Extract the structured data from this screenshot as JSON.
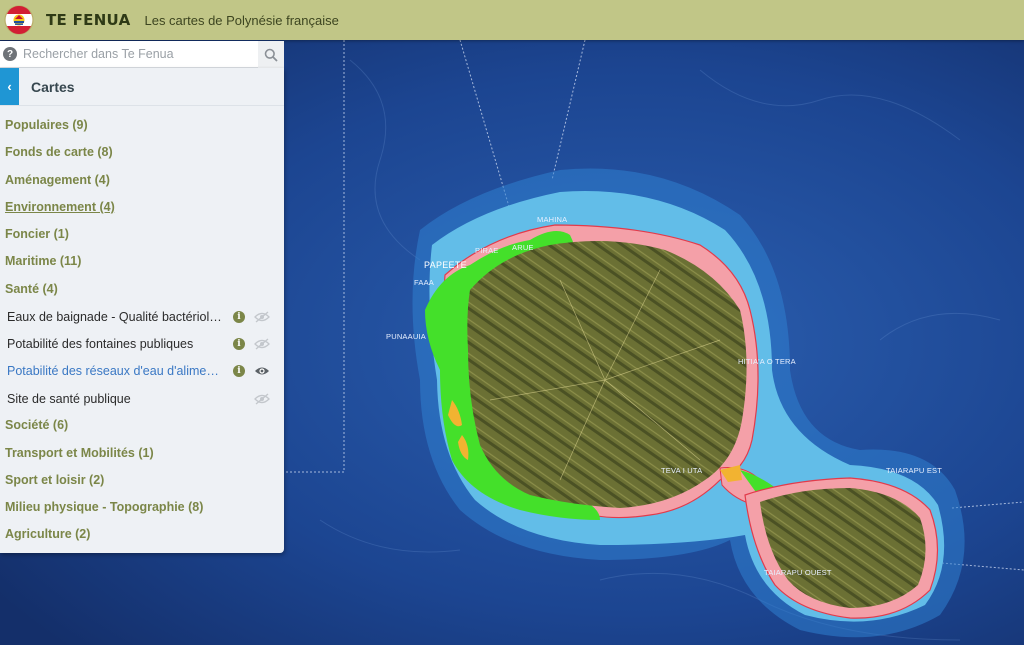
{
  "header": {
    "title": "TE FENUA",
    "subtitle": "Les cartes de Polynésie française"
  },
  "search": {
    "placeholder": "Rechercher dans Te Fenua"
  },
  "panel": {
    "title": "Cartes",
    "categories": [
      {
        "label": "Populaires (9)"
      },
      {
        "label": "Fonds de carte (8)"
      },
      {
        "label": "Aménagement (4)"
      },
      {
        "label": "Environnement (4)"
      },
      {
        "label": "Foncier (1)"
      },
      {
        "label": "Maritime (11)"
      },
      {
        "label": "Santé (4)"
      }
    ],
    "sante_layers": [
      {
        "label": "Eaux de baignade - Qualité bactériologique",
        "visible": false,
        "info": true
      },
      {
        "label": "Potabilité des fontaines publiques",
        "visible": false,
        "info": true
      },
      {
        "label": "Potabilité des réseaux d'eau d'alimentation",
        "visible": true,
        "info": true
      },
      {
        "label": "Site de santé publique",
        "visible": false,
        "info": false
      }
    ],
    "categories_after": [
      {
        "label": "Société (6)"
      },
      {
        "label": "Transport et Mobilités (1)"
      },
      {
        "label": "Sport et loisir (2)"
      },
      {
        "label": "Milieu physique - Topographie (8)"
      },
      {
        "label": "Agriculture (2)"
      }
    ]
  },
  "map": {
    "labels": {
      "papeete": "PAPEETE",
      "pirae": "PIRAE",
      "arue": "ARUE",
      "mahina": "MAHINA",
      "faaa": "FAAA",
      "punaauia": "PUNAAUIA",
      "hitiaa": "HITIA'A O TERA",
      "teva": "TEVA I UTA",
      "tai_est": "TAIARAPU EST",
      "tai_ouest": "TAIARAPU OUEST"
    }
  },
  "colors": {
    "header_bg": "#c1c687",
    "accent_blue": "#1f96d4",
    "category_text": "#7b8648",
    "active_layer": "#3a78c4",
    "potable_green": "#44e02a",
    "non_potable_pink": "#f4a0a8",
    "partial_orange": "#f2b331"
  }
}
